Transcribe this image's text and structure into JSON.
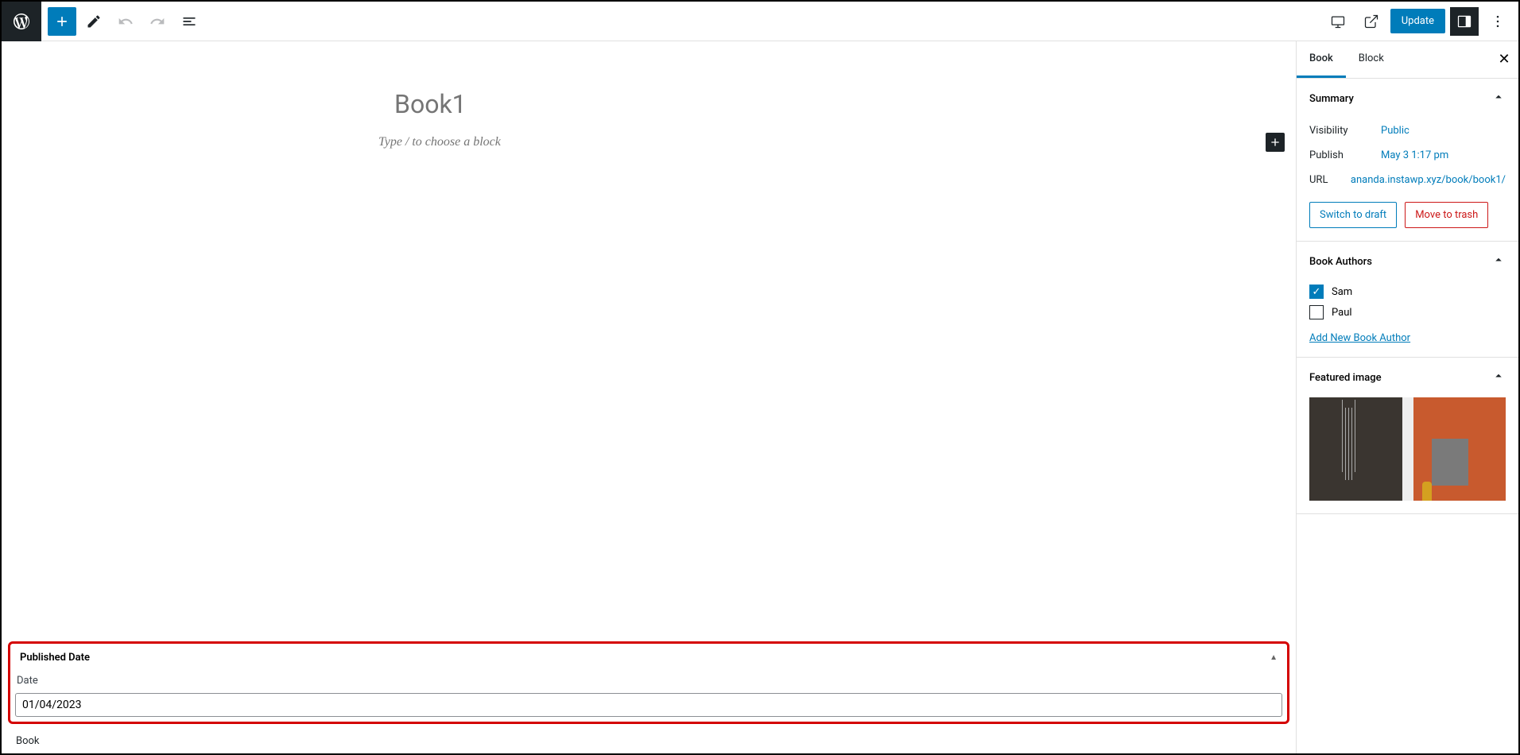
{
  "toolbar": {
    "update_label": "Update"
  },
  "editor": {
    "title": "Book1",
    "block_placeholder": "Type / to choose a block"
  },
  "metabox": {
    "title": "Published Date",
    "field_label": "Date",
    "date_value": "01/04/2023"
  },
  "breadcrumb": {
    "text": "Book"
  },
  "sidebar": {
    "tabs": {
      "book": "Book",
      "block": "Block"
    },
    "summary": {
      "title": "Summary",
      "visibility_label": "Visibility",
      "visibility_value": "Public",
      "publish_label": "Publish",
      "publish_value": "May 3 1:17 pm",
      "url_label": "URL",
      "url_value": "ananda.instawp.xyz/book/book1/",
      "draft_btn": "Switch to draft",
      "trash_btn": "Move to trash"
    },
    "authors": {
      "title": "Book Authors",
      "items": [
        {
          "name": "Sam",
          "checked": true
        },
        {
          "name": "Paul",
          "checked": false
        }
      ],
      "add_link": "Add New Book Author"
    },
    "featured": {
      "title": "Featured image"
    }
  }
}
